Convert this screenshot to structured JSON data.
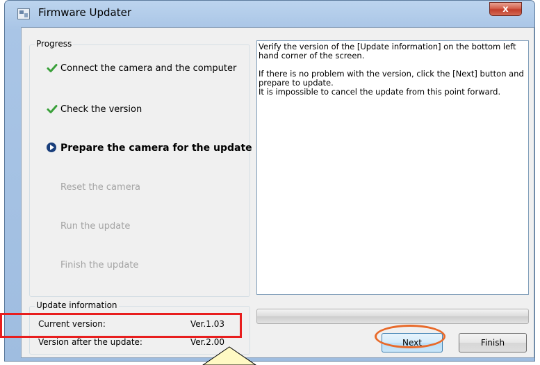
{
  "window": {
    "title": "Firmware Updater",
    "close_label": "x"
  },
  "progress_group": {
    "title": "Progress",
    "steps": [
      {
        "label": "Connect the camera and the computer",
        "state": "done",
        "icon": "check-icon"
      },
      {
        "label": "Check the version",
        "state": "done",
        "icon": "check-icon"
      },
      {
        "label": "Prepare the camera for the update",
        "state": "current",
        "icon": "arrow-circle-icon"
      },
      {
        "label": "Reset the camera",
        "state": "pending"
      },
      {
        "label": "Run the update",
        "state": "pending"
      },
      {
        "label": "Finish the update",
        "state": "pending"
      }
    ]
  },
  "instructions": {
    "line1": "Verify the version of the [Update information] on the bottom left hand corner of the screen.",
    "line2": "If there is no problem with the version, click the [Next] button and prepare to update.",
    "line3": "It is impossible to cancel the update from this point forward."
  },
  "update_info": {
    "title": "Update information",
    "current_label": "Current version:",
    "current_value": "Ver.1.03",
    "after_label": "Version after the update:",
    "after_value": "Ver.2.00"
  },
  "progress_bar": {
    "value": 0
  },
  "buttons": {
    "next_label": "Next",
    "finish_label": "Finish"
  },
  "colors": {
    "highlight_red": "#e81e1e",
    "highlight_orange": "#e86a2a",
    "check_green": "#3aa03a",
    "current_blue": "#1a3f7c"
  }
}
